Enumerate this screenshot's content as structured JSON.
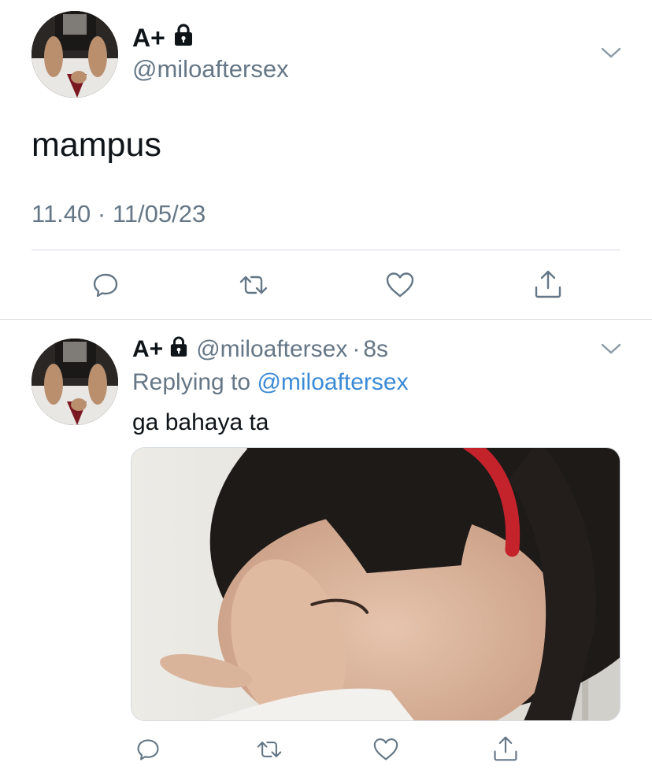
{
  "main_tweet": {
    "display_name": "A+",
    "handle": "@miloaftersex",
    "text": "mampus",
    "timestamp": "11.40 · 11/05/23"
  },
  "reply_tweet": {
    "display_name": "A+",
    "handle": "@miloaftersex",
    "separator": "·",
    "age": "8s",
    "replying_prefix": "Replying to",
    "replying_to": "@miloaftersex",
    "text": "ga bahaya ta"
  },
  "icons": {
    "lock": "lock-icon",
    "chevron": "chevron-down-icon",
    "reply": "reply-icon",
    "retweet": "retweet-icon",
    "like": "heart-icon",
    "share": "share-icon"
  },
  "colors": {
    "text": "#0f1419",
    "secondary": "#657786",
    "link": "#3b8ad6",
    "divider": "#d6dbe0"
  }
}
